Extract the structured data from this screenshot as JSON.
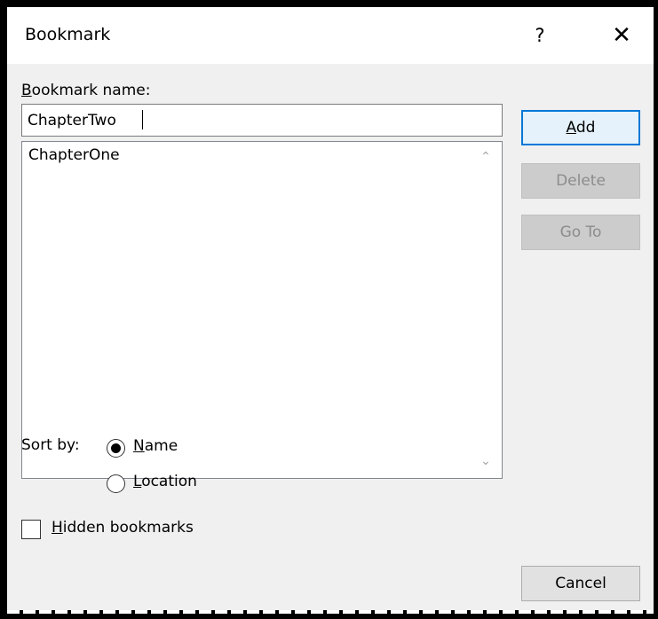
{
  "dialog": {
    "title": "Bookmark",
    "help_glyph": "?",
    "close_glyph": "✕"
  },
  "form": {
    "name_label_access": "B",
    "name_label_rest": "ookmark name:",
    "name_value": "ChapterTwo",
    "list": {
      "items": [
        "ChapterOne"
      ]
    },
    "sort_by_label": "Sort by:",
    "sort_options": [
      {
        "access": "N",
        "rest": "ame",
        "selected": true
      },
      {
        "access": "L",
        "rest": "ocation",
        "selected": false
      }
    ],
    "hidden_access": "H",
    "hidden_rest": "idden bookmarks"
  },
  "buttons": {
    "add_access": "A",
    "add_rest": "dd",
    "delete": "Delete",
    "goto": "Go To",
    "cancel": "Cancel"
  },
  "icons": {
    "scroll_up": "chevron-up-icon",
    "scroll_down": "chevron-down-icon",
    "help": "help-icon",
    "close": "close-icon"
  },
  "colors": {
    "accent": "#0078d7",
    "dialog_bg": "#f0f0f0"
  }
}
